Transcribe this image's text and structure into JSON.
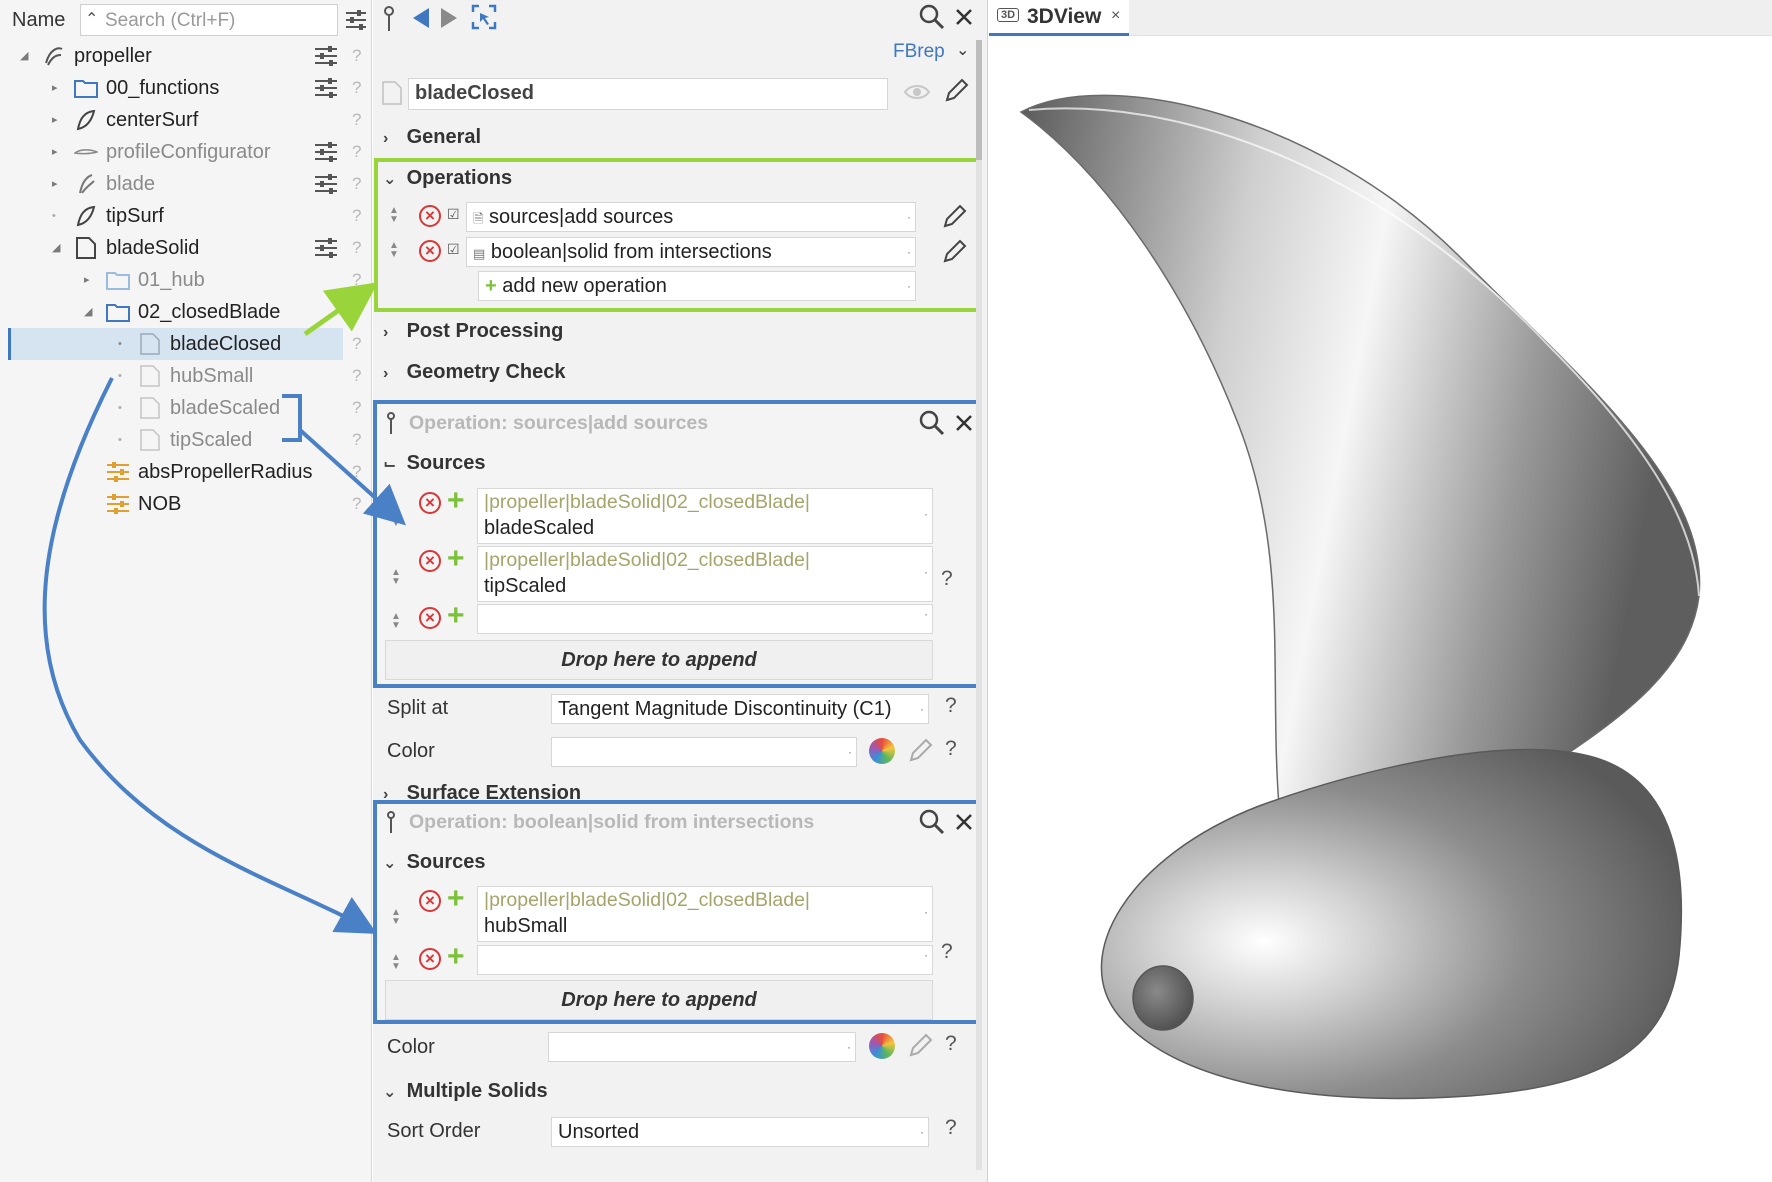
{
  "tree": {
    "header_label": "Name",
    "search_placeholder": "Search (Ctrl+F)",
    "items": [
      {
        "label": "propeller"
      },
      {
        "label": "00_functions"
      },
      {
        "label": "centerSurf"
      },
      {
        "label": "profileConfigurator"
      },
      {
        "label": "blade"
      },
      {
        "label": "tipSurf"
      },
      {
        "label": "bladeSolid"
      },
      {
        "label": "01_hub"
      },
      {
        "label": "02_closedBlade"
      },
      {
        "label": "bladeClosed"
      },
      {
        "label": "hubSmall"
      },
      {
        "label": "bladeScaled"
      },
      {
        "label": "tipScaled"
      },
      {
        "label": "absPropellerRadius"
      },
      {
        "label": "NOB"
      }
    ],
    "help_glyph": "?"
  },
  "properties": {
    "type_label": "FBrep",
    "object_name": "bladeClosed",
    "sections": {
      "general": "General",
      "operations": "Operations",
      "post_processing": "Post Processing",
      "geometry_check": "Geometry Check",
      "surface_extension": "Surface Extension",
      "multiple_solids": "Multiple Solids"
    },
    "operations": [
      {
        "label": "sources|add sources"
      },
      {
        "label": "boolean|solid from intersections"
      }
    ],
    "add_operation_label": "add new operation",
    "op1": {
      "title": "Operation: sources|add sources",
      "sources_header": "Sources",
      "sources": [
        {
          "path": "|propeller|bladeSolid|02_closedBlade|",
          "name": "bladeScaled"
        },
        {
          "path": "|propeller|bladeSolid|02_closedBlade|",
          "name": "tipScaled"
        }
      ],
      "drop_label": "Drop here to append"
    },
    "split_at": {
      "label": "Split at",
      "value": "Tangent Magnitude Discontinuity (C1)"
    },
    "color1": {
      "label": "Color",
      "value": ""
    },
    "op2": {
      "title": "Operation: boolean|solid from intersections",
      "sources_header": "Sources",
      "sources": [
        {
          "path": "|propeller|bladeSolid|02_closedBlade|",
          "name": "hubSmall"
        }
      ],
      "drop_label": "Drop here to append"
    },
    "color2": {
      "label": "Color",
      "value": ""
    },
    "sort_order": {
      "label": "Sort Order",
      "value": "Unsorted"
    },
    "help_glyph": "?"
  },
  "view3d": {
    "tab_label": "3DView",
    "tab_icon": "3D"
  },
  "colors": {
    "highlight_green": "#9ad43b",
    "highlight_blue": "#4a80c6",
    "remove_red": "#d93636",
    "add_green": "#7cc13a",
    "selection": "#d6e4f2",
    "accent": "#3f78c0"
  }
}
